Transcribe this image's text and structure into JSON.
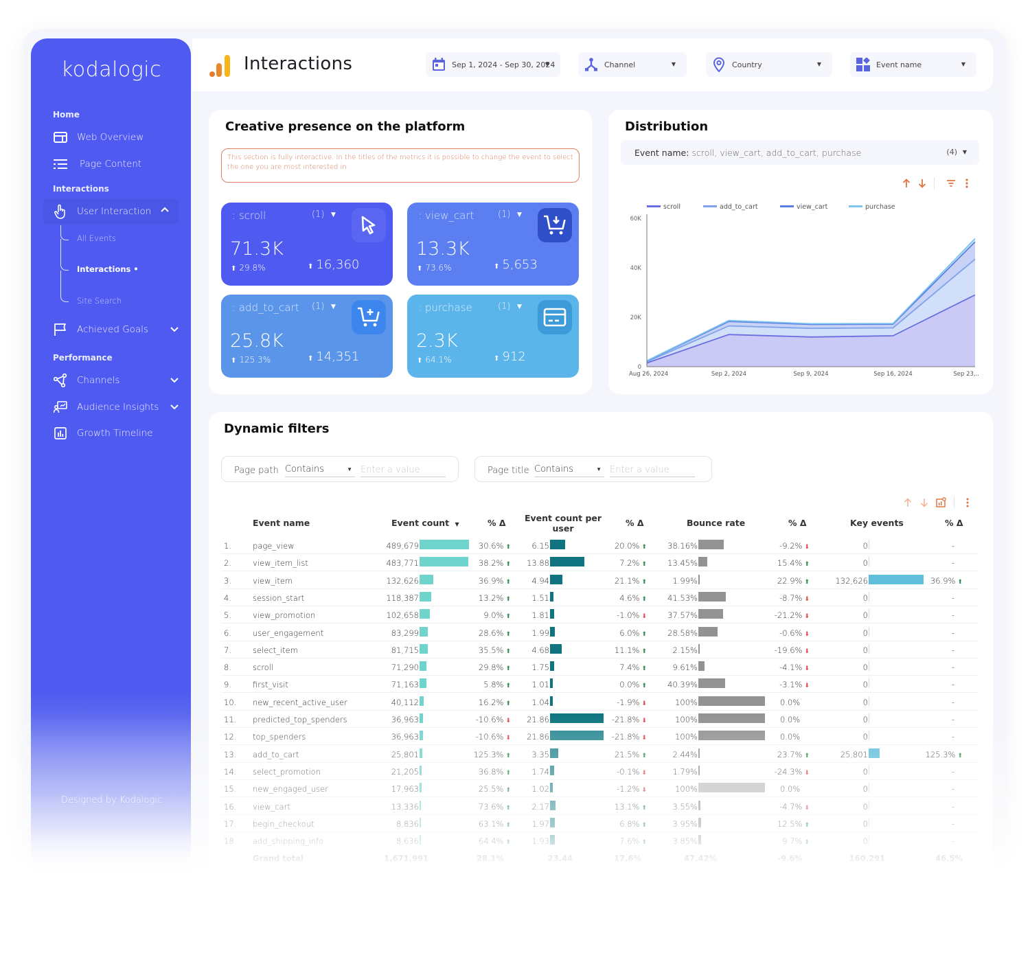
{
  "app": {
    "logo_text": "kodalogic",
    "footer_text": "Designed by Kodalogic"
  },
  "sidebar": {
    "sections": [
      {
        "label": "Home"
      },
      {
        "label": "Interactions"
      },
      {
        "label": "Performance"
      }
    ],
    "items": [
      {
        "label": "Web Overview",
        "icon": "layout-icon"
      },
      {
        "label": "Page Content",
        "icon": "list-icon"
      },
      {
        "label": "User Interaction",
        "icon": "hand-pointer-icon",
        "expanded": true,
        "active": true
      },
      {
        "label": "Achieved Goals",
        "icon": "flag-icon"
      },
      {
        "label": "Channels",
        "icon": "share-nodes-icon"
      },
      {
        "label": "Audience Insights",
        "icon": "presentation-icon"
      },
      {
        "label": "Growth Timeline",
        "icon": "bar-chart-icon"
      }
    ],
    "sub_items": [
      {
        "label": "All Events"
      },
      {
        "label": "Interactions •",
        "current": true
      },
      {
        "label": "Site Search"
      }
    ]
  },
  "header": {
    "title": "Interactions",
    "controls": [
      {
        "label": "Sep 1, 2024 - Sep 30, 2024",
        "icon": "calendar-icon"
      },
      {
        "label": "Channel",
        "icon": "channel-icon"
      },
      {
        "label": "Country",
        "icon": "location-pin-icon"
      },
      {
        "label": "Event name",
        "icon": "shapes-icon"
      }
    ]
  },
  "creative": {
    "title": "Creative presence on the platform",
    "notice": "This section is fully interactive. In the titles of the metrics it is possible to change the event to select the one you are most interested in.",
    "kpis": [
      {
        "label": ": scroll",
        "count": "(1)",
        "value": "71.3K",
        "delta": "29.8%",
        "prev": "16,360",
        "icon": "cursor-icon",
        "bg": "#4f5bf0",
        "icon_bg": "#5a66f2"
      },
      {
        "label": ": view_cart",
        "count": "(1)",
        "value": "13.3K",
        "delta": "73.6%",
        "prev": "5,653",
        "icon": "cart-download-icon",
        "bg": "#5b7ef0",
        "icon_bg": "#2f4fc8"
      },
      {
        "label": ": add_to_cart",
        "count": "(1)",
        "value": "25.8K",
        "delta": "125.3%",
        "prev": "14,351",
        "icon": "cart-plus-icon",
        "bg": "#5b95ea",
        "icon_bg": "#3d86ee"
      },
      {
        "label": ": purchase",
        "count": "(1)",
        "value": "2.3K",
        "delta": "64.1%",
        "prev": "912",
        "icon": "credit-card-icon",
        "bg": "#5cb5ea",
        "icon_bg": "#3c9bd8"
      }
    ]
  },
  "distribution": {
    "title": "Distribution",
    "filter_name": "Event name:",
    "filter_values": "scroll, view_cart, add_to_cart, purchase",
    "filter_count": "(4)"
  },
  "chart_data": {
    "type": "area",
    "stacked": true,
    "title": "",
    "x": [
      "Aug 26, 2024",
      "Sep 2, 2024",
      "Sep 9, 2024",
      "Sep 16, 2024",
      "Sep 23,.."
    ],
    "series": [
      {
        "name": "scroll",
        "color": "#6a6fe0",
        "fill": "#cbcaf6",
        "values": [
          1500,
          13000,
          12000,
          12500,
          29000
        ]
      },
      {
        "name": "add_to_cart",
        "color": "#7fa2ea",
        "fill": "#d1e0f8",
        "values": [
          500,
          3500,
          3500,
          3200,
          14500
        ]
      },
      {
        "name": "view_cart",
        "color": "#5a7fe0",
        "fill": "#c8d2f6",
        "values": [
          300,
          1800,
          1600,
          1500,
          7000
        ]
      },
      {
        "name": "purchase",
        "color": "#7cc4ee",
        "fill": "#d3ebfa",
        "values": [
          100,
          400,
          300,
          300,
          1300
        ]
      }
    ],
    "yticks": [
      "0",
      "20K",
      "40K",
      "60K"
    ],
    "ylim": [
      0,
      60000
    ],
    "legend": "top-left",
    "grid": false
  },
  "dynamic_filters": {
    "title": "Dynamic filters",
    "filters": [
      {
        "label": "Page path",
        "operator": "Contains",
        "placeholder": "Enter a value"
      },
      {
        "label": "Page title",
        "operator": "Contains",
        "placeholder": "Enter a value"
      }
    ]
  },
  "table": {
    "headers": {
      "event_name": "Event name",
      "event_count": "Event count",
      "ec_delta": "% Δ",
      "ecpu": "Event count per user",
      "ecpu_delta": "% Δ",
      "bounce": "Bounce rate",
      "bounce_delta": "% Δ",
      "key": "Key events",
      "key_delta": "% Δ"
    },
    "rows": [
      {
        "idx": "1.",
        "name": "page_view",
        "count": "489,679",
        "count_v": 489679,
        "cd": "30.6%",
        "cd_dir": "up",
        "ecpu": "6.15",
        "ecpu_v": 6.15,
        "ed": "20.0%",
        "ed_dir": "up",
        "bounce": "38.16%",
        "bounce_v": 38.16,
        "bd": "-9.2%",
        "bd_dir": "down",
        "key": "0",
        "key_v": 0,
        "kd": "-",
        "kd_dir": ""
      },
      {
        "idx": "2.",
        "name": "view_item_list",
        "count": "483,771",
        "count_v": 483771,
        "cd": "38.2%",
        "cd_dir": "up",
        "ecpu": "13.88",
        "ecpu_v": 13.88,
        "ed": "7.2%",
        "ed_dir": "up",
        "bounce": "13.45%",
        "bounce_v": 13.45,
        "bd": "15.4%",
        "bd_dir": "up",
        "key": "0",
        "key_v": 0,
        "kd": "-",
        "kd_dir": ""
      },
      {
        "idx": "3.",
        "name": "view_item",
        "count": "132,626",
        "count_v": 132626,
        "cd": "36.9%",
        "cd_dir": "up",
        "ecpu": "4.94",
        "ecpu_v": 4.94,
        "ed": "21.1%",
        "ed_dir": "up",
        "bounce": "1.99%",
        "bounce_v": 1.99,
        "bd": "22.9%",
        "bd_dir": "up",
        "key": "132,626",
        "key_v": 132626,
        "kd": "36.9%",
        "kd_dir": "up"
      },
      {
        "idx": "4.",
        "name": "session_start",
        "count": "118,387",
        "count_v": 118387,
        "cd": "13.2%",
        "cd_dir": "up",
        "ecpu": "1.51",
        "ecpu_v": 1.51,
        "ed": "4.6%",
        "ed_dir": "up",
        "bounce": "41.53%",
        "bounce_v": 41.53,
        "bd": "-8.7%",
        "bd_dir": "down",
        "key": "0",
        "key_v": 0,
        "kd": "-",
        "kd_dir": ""
      },
      {
        "idx": "5.",
        "name": "view_promotion",
        "count": "102,658",
        "count_v": 102658,
        "cd": "9.0%",
        "cd_dir": "up",
        "ecpu": "1.81",
        "ecpu_v": 1.81,
        "ed": "-1.0%",
        "ed_dir": "down",
        "bounce": "37.57%",
        "bounce_v": 37.57,
        "bd": "-21.2%",
        "bd_dir": "down",
        "key": "0",
        "key_v": 0,
        "kd": "-",
        "kd_dir": ""
      },
      {
        "idx": "6.",
        "name": "user_engagement",
        "count": "83,299",
        "count_v": 83299,
        "cd": "28.6%",
        "cd_dir": "up",
        "ecpu": "1.99",
        "ecpu_v": 1.99,
        "ed": "6.0%",
        "ed_dir": "up",
        "bounce": "28.58%",
        "bounce_v": 28.58,
        "bd": "-0.6%",
        "bd_dir": "down",
        "key": "0",
        "key_v": 0,
        "kd": "-",
        "kd_dir": ""
      },
      {
        "idx": "7.",
        "name": "select_item",
        "count": "81,715",
        "count_v": 81715,
        "cd": "35.5%",
        "cd_dir": "up",
        "ecpu": "4.68",
        "ecpu_v": 4.68,
        "ed": "11.1%",
        "ed_dir": "up",
        "bounce": "2.15%",
        "bounce_v": 2.15,
        "bd": "-19.6%",
        "bd_dir": "down",
        "key": "0",
        "key_v": 0,
        "kd": "-",
        "kd_dir": ""
      },
      {
        "idx": "8.",
        "name": "scroll",
        "count": "71,290",
        "count_v": 71290,
        "cd": "29.8%",
        "cd_dir": "up",
        "ecpu": "1.75",
        "ecpu_v": 1.75,
        "ed": "7.4%",
        "ed_dir": "up",
        "bounce": "9.61%",
        "bounce_v": 9.61,
        "bd": "-4.1%",
        "bd_dir": "down",
        "key": "0",
        "key_v": 0,
        "kd": "-",
        "kd_dir": ""
      },
      {
        "idx": "9.",
        "name": "first_visit",
        "count": "71,163",
        "count_v": 71163,
        "cd": "5.8%",
        "cd_dir": "up",
        "ecpu": "1.01",
        "ecpu_v": 1.01,
        "ed": "0.0%",
        "ed_dir": "up",
        "bounce": "40.39%",
        "bounce_v": 40.39,
        "bd": "-3.1%",
        "bd_dir": "down",
        "key": "0",
        "key_v": 0,
        "kd": "-",
        "kd_dir": ""
      },
      {
        "idx": "10.",
        "name": "new_recent_active_user",
        "count": "40,112",
        "count_v": 40112,
        "cd": "16.2%",
        "cd_dir": "up",
        "ecpu": "1.04",
        "ecpu_v": 1.04,
        "ed": "-1.9%",
        "ed_dir": "down",
        "bounce": "100%",
        "bounce_v": 100,
        "bd": "0.0%",
        "bd_dir": "",
        "key": "0",
        "key_v": 0,
        "kd": "-",
        "kd_dir": ""
      },
      {
        "idx": "11.",
        "name": "predicted_top_spenders",
        "count": "36,963",
        "count_v": 36963,
        "cd": "-10.6%",
        "cd_dir": "down",
        "ecpu": "21.86",
        "ecpu_v": 21.86,
        "ed": "-21.8%",
        "ed_dir": "down",
        "bounce": "100%",
        "bounce_v": 100,
        "bd": "0.0%",
        "bd_dir": "",
        "key": "0",
        "key_v": 0,
        "kd": "-",
        "kd_dir": ""
      },
      {
        "idx": "12.",
        "name": "top_spenders",
        "count": "36,963",
        "count_v": 36963,
        "cd": "-10.6%",
        "cd_dir": "down",
        "ecpu": "21.86",
        "ecpu_v": 21.86,
        "ed": "-21.8%",
        "ed_dir": "down",
        "bounce": "100%",
        "bounce_v": 100,
        "bd": "0.0%",
        "bd_dir": "",
        "key": "0",
        "key_v": 0,
        "kd": "-",
        "kd_dir": ""
      },
      {
        "idx": "13.",
        "name": "add_to_cart",
        "count": "25,801",
        "count_v": 25801,
        "cd": "125.3%",
        "cd_dir": "up",
        "ecpu": "3.35",
        "ecpu_v": 3.35,
        "ed": "21.5%",
        "ed_dir": "up",
        "bounce": "2.44%",
        "bounce_v": 2.44,
        "bd": "23.7%",
        "bd_dir": "up",
        "key": "25,801",
        "key_v": 25801,
        "kd": "125.3%",
        "kd_dir": "up"
      },
      {
        "idx": "14.",
        "name": "select_promotion",
        "count": "21,205",
        "count_v": 21205,
        "cd": "36.8%",
        "cd_dir": "up",
        "ecpu": "1.74",
        "ecpu_v": 1.74,
        "ed": "-0.1%",
        "ed_dir": "down",
        "bounce": "1.79%",
        "bounce_v": 1.79,
        "bd": "-24.3%",
        "bd_dir": "down",
        "key": "0",
        "key_v": 0,
        "kd": "-",
        "kd_dir": ""
      },
      {
        "idx": "15.",
        "name": "new_engaged_user",
        "count": "17,963",
        "count_v": 17963,
        "cd": "25.5%",
        "cd_dir": "up",
        "ecpu": "1.02",
        "ecpu_v": 1.02,
        "ed": "-1.2%",
        "ed_dir": "down",
        "bounce": "100%",
        "bounce_v": 100,
        "bd": "0.0%",
        "bd_dir": "",
        "key": "0",
        "key_v": 0,
        "kd": "-",
        "kd_dir": ""
      },
      {
        "idx": "16.",
        "name": "view_cart",
        "count": "13,336",
        "count_v": 13336,
        "cd": "73.6%",
        "cd_dir": "up",
        "ecpu": "2.17",
        "ecpu_v": 2.17,
        "ed": "13.1%",
        "ed_dir": "up",
        "bounce": "3.55%",
        "bounce_v": 3.55,
        "bd": "-4.7%",
        "bd_dir": "down",
        "key": "0",
        "key_v": 0,
        "kd": "-",
        "kd_dir": ""
      },
      {
        "idx": "17.",
        "name": "begin_checkout",
        "count": "8,836",
        "count_v": 8836,
        "cd": "63.1%",
        "cd_dir": "up",
        "ecpu": "1.97",
        "ecpu_v": 1.97,
        "ed": "6.8%",
        "ed_dir": "up",
        "bounce": "3.95%",
        "bounce_v": 3.95,
        "bd": "12.5%",
        "bd_dir": "up",
        "key": "0",
        "key_v": 0,
        "kd": "-",
        "kd_dir": ""
      },
      {
        "idx": "18.",
        "name": "add_shipping_info",
        "count": "8,636",
        "count_v": 8636,
        "cd": "64.4%",
        "cd_dir": "up",
        "ecpu": "1.93",
        "ecpu_v": 1.93,
        "ed": "7.6%",
        "ed_dir": "up",
        "bounce": "3.85%",
        "bounce_v": 3.85,
        "bd": "9.7%",
        "bd_dir": "up",
        "key": "0",
        "key_v": 0,
        "kd": "-",
        "kd_dir": ""
      }
    ],
    "grand_total": {
      "label": "Grand total",
      "count": "1,671,991",
      "cd": "28.1%",
      "ecpu": "23.44",
      "ed": "17.6%",
      "bounce": "47.42%",
      "bd": "-9.6%",
      "key": "160,291",
      "kd": "46.5%"
    }
  }
}
